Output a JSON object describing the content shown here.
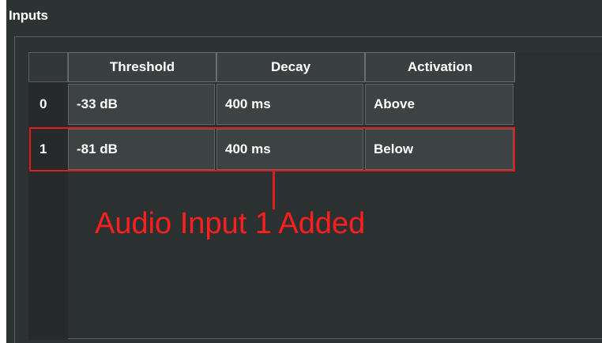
{
  "panel": {
    "title": "Inputs"
  },
  "table": {
    "columns": [
      "Threshold",
      "Decay",
      "Activation"
    ],
    "rows": [
      {
        "index": "0",
        "threshold": "-33 dB",
        "decay": "400 ms",
        "activation": "Above"
      },
      {
        "index": "1",
        "threshold": "-81 dB",
        "decay": "400 ms",
        "activation": "Below"
      }
    ]
  },
  "annotation": {
    "text": "Audio Input 1 Added",
    "color": "#e01c1c"
  }
}
